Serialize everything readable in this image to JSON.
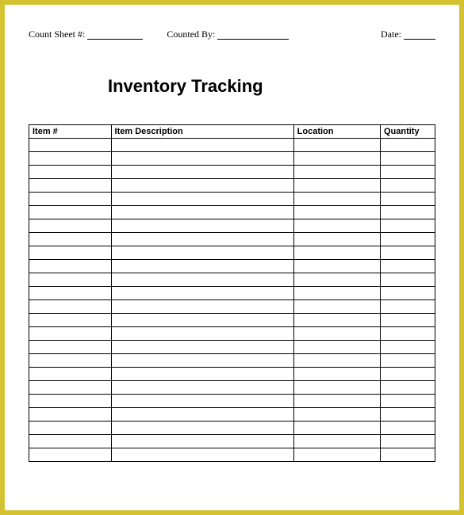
{
  "header": {
    "count_sheet_label": "Count Sheet #:",
    "counted_by_label": "Counted By:",
    "date_label": "Date:"
  },
  "title": "Inventory Tracking",
  "columns": {
    "item_no": "Item #",
    "description": "Item Description",
    "location": "Location",
    "quantity": "Quantity"
  },
  "row_count": 24
}
